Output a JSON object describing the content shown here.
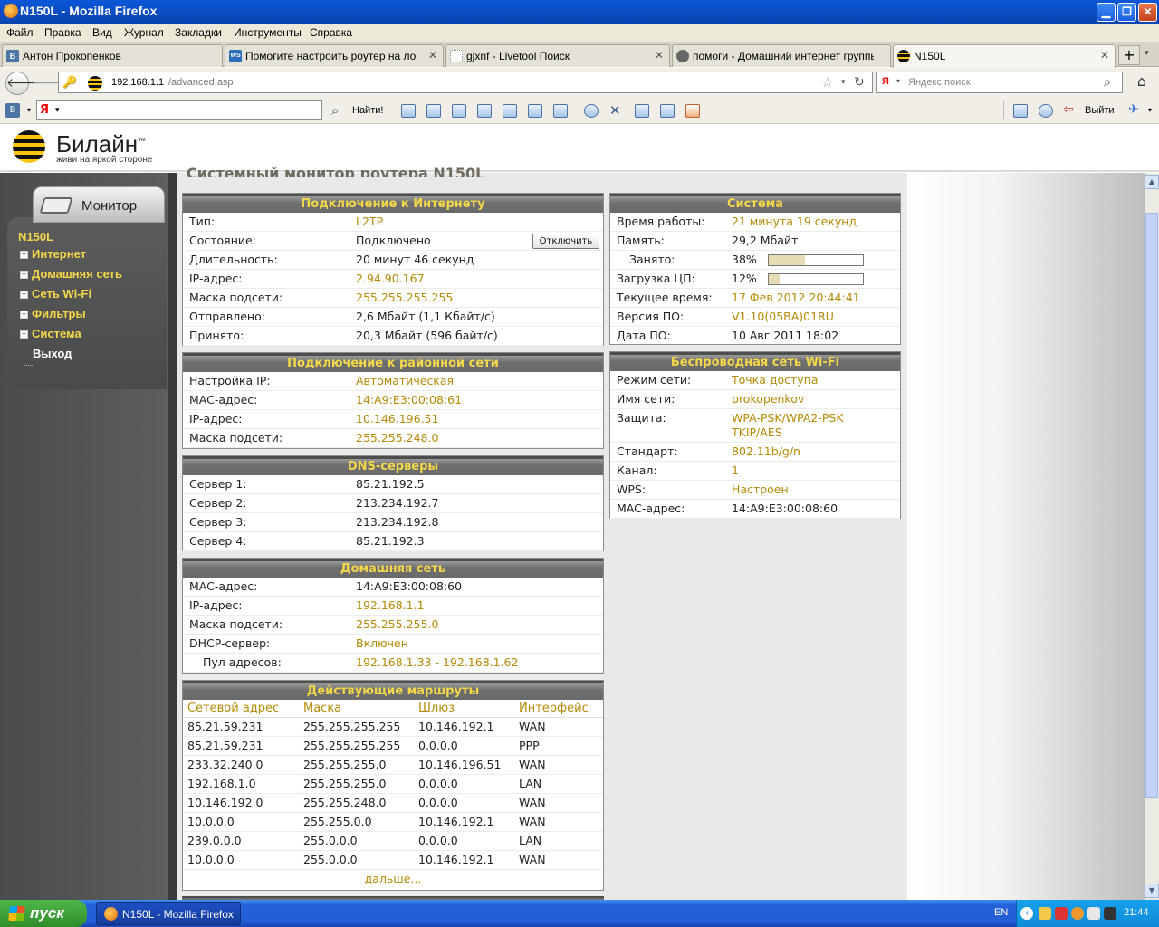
{
  "window": {
    "title": "N150L - Mozilla Firefox"
  },
  "menu": [
    "Файл",
    "Правка",
    "Вид",
    "Журнал",
    "Закладки",
    "Инструменты",
    "Справка"
  ],
  "tabs": [
    {
      "label": "Антон Прокопенков",
      "icon": "В"
    },
    {
      "label": "Помогите настроить роутер на локал...",
      "icon": "WS"
    },
    {
      "label": "gjxnf - Livetool Поиск",
      "icon": ""
    },
    {
      "label": "помоги - Домашний интернет группы ...",
      "icon": ""
    },
    {
      "label": "N150L",
      "icon": ""
    }
  ],
  "address": {
    "host": "192.168.1.1",
    "path": "/advanced.asp"
  },
  "search": {
    "placeholder": "Яндекс поиск",
    "engine": "Я"
  },
  "yabar": {
    "find_label": "Найти!",
    "logout_label": "Выйти",
    "vk": "В",
    "ya": "Я"
  },
  "brand": {
    "name": "Билайн",
    "tm": "™",
    "tagline": "живи на яркой стороне"
  },
  "sidebar": {
    "tab_label": "Монитор",
    "device": "N150L",
    "items": [
      "Интернет",
      "Домашняя сеть",
      "Сеть Wi-Fi",
      "Фильтры",
      "Система"
    ],
    "exit_label": "Выход"
  },
  "page_title": "Системный монитор роутера N150L",
  "internet": {
    "title": "Подключение к Интернету",
    "rows": [
      {
        "k": "Тип:",
        "v": "L2TP"
      },
      {
        "k": "Состояние:",
        "v": "Подключено"
      },
      {
        "k": "Длительность:",
        "v": "20 минут 46 секунд"
      },
      {
        "k": "IP-адрес:",
        "v": "2.94.90.167"
      },
      {
        "k": "Маска подсети:",
        "v": "255.255.255.255"
      },
      {
        "k": "Отправлено:",
        "v": "2,6 Мбайт (1,1 Кбайт/с)"
      },
      {
        "k": "Принято:",
        "v": "20,3 Мбайт (596 байт/с)"
      }
    ],
    "disconnect_label": "Отключить"
  },
  "lan_isp": {
    "title": "Подключение к районной сети",
    "rows": [
      {
        "k": "Настройка IP:",
        "v": "Автоматическая"
      },
      {
        "k": "MAC-адрес:",
        "v": "14:A9:E3:00:08:61"
      },
      {
        "k": "IP-адрес:",
        "v": "10.146.196.51"
      },
      {
        "k": "Маска подсети:",
        "v": "255.255.248.0"
      }
    ]
  },
  "dns": {
    "title": "DNS-серверы",
    "rows": [
      {
        "k": "Сервер 1:",
        "v": "85.21.192.5"
      },
      {
        "k": "Сервер 2:",
        "v": "213.234.192.7"
      },
      {
        "k": "Сервер 3:",
        "v": "213.234.192.8"
      },
      {
        "k": "Сервер 4:",
        "v": "85.21.192.3"
      }
    ]
  },
  "home": {
    "title": "Домашняя сеть",
    "rows": [
      {
        "k": "MAC-адрес:",
        "v": "14:A9:E3:00:08:60"
      },
      {
        "k": "IP-адрес:",
        "v": "192.168.1.1"
      },
      {
        "k": "Маска подсети:",
        "v": "255.255.255.0"
      },
      {
        "k": "DHCP-сервер:",
        "v": "Включен"
      },
      {
        "k": "Пул адресов:",
        "v": "192.168.1.33 - 192.168.1.62"
      }
    ]
  },
  "routes": {
    "title": "Действующие маршруты",
    "headers": [
      "Сетевой адрес",
      "Маска",
      "Шлюз",
      "Интерфейс"
    ],
    "rows": [
      [
        "85.21.59.231",
        "255.255.255.255",
        "10.146.192.1",
        "WAN"
      ],
      [
        "85.21.59.231",
        "255.255.255.255",
        "0.0.0.0",
        "PPP"
      ],
      [
        "233.32.240.0",
        "255.255.255.0",
        "10.146.196.51",
        "WAN"
      ],
      [
        "192.168.1.0",
        "255.255.255.0",
        "0.0.0.0",
        "LAN"
      ],
      [
        "10.146.192.0",
        "255.255.248.0",
        "0.0.0.0",
        "WAN"
      ],
      [
        "10.0.0.0",
        "255.255.0.0",
        "10.146.192.1",
        "WAN"
      ],
      [
        "239.0.0.0",
        "255.0.0.0",
        "0.0.0.0",
        "LAN"
      ],
      [
        "10.0.0.0",
        "255.0.0.0",
        "10.146.192.1",
        "WAN"
      ]
    ],
    "more_label": "дальше..."
  },
  "system": {
    "title": "Система",
    "uptime_k": "Время работы:",
    "uptime_v": "21 минута 19 секунд",
    "mem_k": "Память:",
    "mem_v": "29,2 Мбайт",
    "used_k": "Занято:",
    "used_v": "38%",
    "used_frac": 0.38,
    "cpu_k": "Загрузка ЦП:",
    "cpu_v": "12%",
    "cpu_frac": 0.12,
    "time_k": "Текущее время:",
    "time_v": "17 Фев 2012 20:44:41",
    "fw_k": "Версия ПО:",
    "fw_v": "V1.10(05BA)01RU",
    "date_k": "Дата ПО:",
    "date_v": "10 Авг 2011 18:02"
  },
  "wifi": {
    "title": "Беспроводная сеть Wi-Fi",
    "mode_k": "Режим сети:",
    "mode_v": "Точка доступа",
    "ssid_k": "Имя сети:",
    "ssid_v": "prokopenkov",
    "sec_k": "Защита:",
    "sec_v1": "WPA-PSK/WPA2-PSK",
    "sec_v2": "TKIP/AES",
    "std_k": "Стандарт:",
    "std_v": "802.11b/g/n",
    "ch_k": "Канал:",
    "ch_v": "1",
    "wps_k": "WPS:",
    "wps_v": "Настроен",
    "mac_k": "MAC-адрес:",
    "mac_v": "14:A9:E3:00:08:60"
  },
  "taskbar": {
    "start_label": "пуск",
    "task_label": "N150L - Mozilla Firefox",
    "lang": "EN",
    "clock": "21:44"
  }
}
